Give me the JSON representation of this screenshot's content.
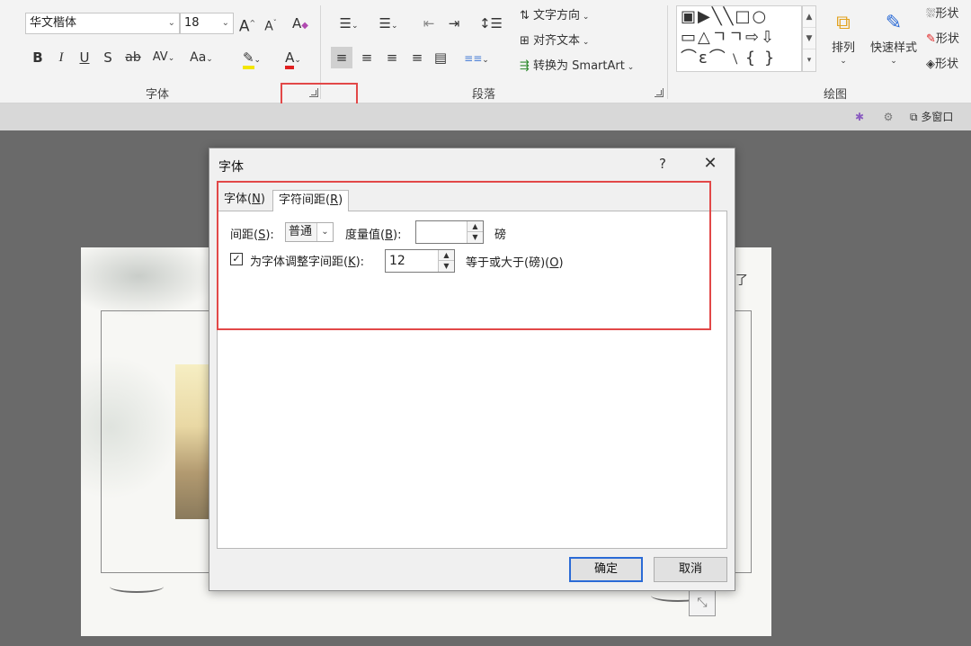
{
  "ribbon": {
    "font_group": {
      "font_name": "华文楷体",
      "font_size": "18",
      "grow_label": "A",
      "shrink_label": "A",
      "bold": "B",
      "italic": "I",
      "underline": "U",
      "shadow": "S",
      "strike": "ab",
      "spacing": "AV",
      "case": "Aa",
      "font_color": "A",
      "label": "字体"
    },
    "paragraph_group": {
      "text_direction": "文字方向",
      "align_text": "对齐文本",
      "convert_smartart": "转换为 SmartArt",
      "label": "段落"
    },
    "drawing_group": {
      "shapes_row1": "▣▶╲╲□○",
      "shapes_row2": "▭△ㄱㄱ⇨⇩",
      "shapes_row3": "⌒ε⌒﹨{ }",
      "arrange": "排列",
      "quick_styles": "快速样式",
      "shape_fill": "形状",
      "shape_outline": "形状",
      "shape_effects": "形状",
      "label": "绘图"
    }
  },
  "strip": {
    "multi_window": "多窗口"
  },
  "slide": {
    "side_text": "了"
  },
  "dialog": {
    "title": "字体",
    "help": "?",
    "close": "✕",
    "tabs": [
      {
        "label": "字体(",
        "hotkey": "N",
        "suffix": ")"
      },
      {
        "label": "字符间距(",
        "hotkey": "R",
        "suffix": ")"
      }
    ],
    "spacing_label": "间距(",
    "spacing_hotkey": "S",
    "spacing_suffix": "):",
    "spacing_value": "普通",
    "by_label": "度量值(",
    "by_hotkey": "B",
    "by_suffix": "):",
    "by_value": "",
    "by_unit": "磅",
    "kerning_checked": "✓",
    "kerning_label": "为字体调整字间距(",
    "kerning_hotkey": "K",
    "kerning_suffix": "):",
    "kerning_value": "12",
    "kerning_unit_label": "等于或大于(磅)(",
    "kerning_unit_hotkey": "O",
    "kerning_unit_suffix": ")",
    "ok": "确定",
    "cancel": "取消"
  },
  "colors": {
    "highlight_box": "#e24848",
    "default_button_border": "#2b6bd6"
  }
}
